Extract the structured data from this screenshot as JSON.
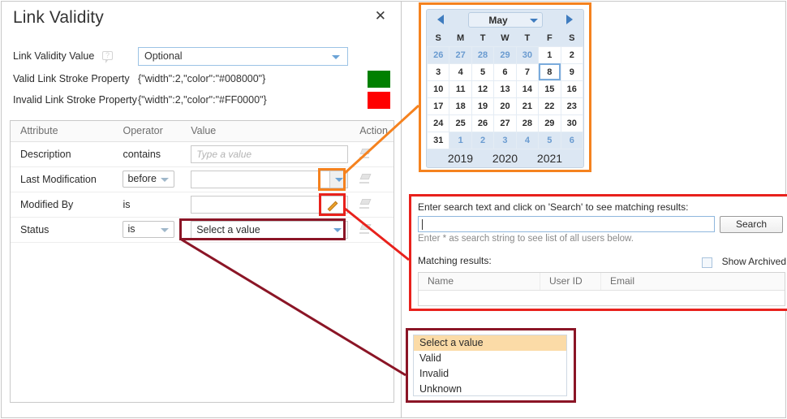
{
  "dialog": {
    "title": "Link Validity",
    "close_label": "✕",
    "properties": [
      {
        "label": "Link Validity Value",
        "help_icon": "help-bubble-icon",
        "control": "combobox",
        "value": "Optional"
      },
      {
        "label": "Valid Link Stroke Property",
        "value": "{\"width\":2,\"color\":\"#008000\"}",
        "swatch_color": "#008000"
      },
      {
        "label": "Invalid Link Stroke Property",
        "value": "{\"width\":2,\"color\":\"#FF0000\"}",
        "swatch_color": "#FF0000"
      }
    ],
    "table": {
      "headers": [
        "Attribute",
        "Operator",
        "Value",
        "Action"
      ],
      "rows": [
        {
          "attribute": "Description",
          "operator": "contains",
          "operator_is_combo": false,
          "value": "",
          "value_placeholder": "Type a value",
          "value_kind": "text",
          "action_icon": "eraser-icon"
        },
        {
          "attribute": "Last Modification",
          "operator": "before",
          "operator_is_combo": true,
          "value": "",
          "value_placeholder": "",
          "value_kind": "date-picker",
          "action_icon": "eraser-icon"
        },
        {
          "attribute": "Modified By",
          "operator": "is",
          "operator_is_combo": false,
          "value": "",
          "value_placeholder": "",
          "value_kind": "user-picker",
          "action_icon": "eraser-icon"
        },
        {
          "attribute": "Status",
          "operator": "is",
          "operator_is_combo": true,
          "value": "Select a value",
          "value_placeholder": "",
          "value_kind": "select",
          "action_icon": "eraser-icon"
        }
      ]
    }
  },
  "calendar": {
    "month": "May",
    "prev_icon": "chevron-left-icon",
    "next_icon": "chevron-right-icon",
    "dropdown_icon": "chevron-down-icon",
    "weekdays": [
      "S",
      "M",
      "T",
      "W",
      "T",
      "F",
      "S"
    ],
    "weeks": [
      [
        {
          "d": "26",
          "o": true
        },
        {
          "d": "27",
          "o": true
        },
        {
          "d": "28",
          "o": true
        },
        {
          "d": "29",
          "o": true
        },
        {
          "d": "30",
          "o": true
        },
        {
          "d": "1",
          "o": false
        },
        {
          "d": "2",
          "o": false
        }
      ],
      [
        {
          "d": "3",
          "o": false
        },
        {
          "d": "4",
          "o": false
        },
        {
          "d": "5",
          "o": false
        },
        {
          "d": "6",
          "o": false
        },
        {
          "d": "7",
          "o": false
        },
        {
          "d": "8",
          "o": false,
          "sel": true
        },
        {
          "d": "9",
          "o": false
        }
      ],
      [
        {
          "d": "10",
          "o": false
        },
        {
          "d": "11",
          "o": false
        },
        {
          "d": "12",
          "o": false
        },
        {
          "d": "13",
          "o": false
        },
        {
          "d": "14",
          "o": false
        },
        {
          "d": "15",
          "o": false
        },
        {
          "d": "16",
          "o": false
        }
      ],
      [
        {
          "d": "17",
          "o": false
        },
        {
          "d": "18",
          "o": false
        },
        {
          "d": "19",
          "o": false
        },
        {
          "d": "20",
          "o": false
        },
        {
          "d": "21",
          "o": false
        },
        {
          "d": "22",
          "o": false
        },
        {
          "d": "23",
          "o": false
        }
      ],
      [
        {
          "d": "24",
          "o": false
        },
        {
          "d": "25",
          "o": false
        },
        {
          "d": "26",
          "o": false
        },
        {
          "d": "27",
          "o": false
        },
        {
          "d": "28",
          "o": false
        },
        {
          "d": "29",
          "o": false
        },
        {
          "d": "30",
          "o": false
        }
      ],
      [
        {
          "d": "31",
          "o": false
        },
        {
          "d": "1",
          "o": true
        },
        {
          "d": "2",
          "o": true
        },
        {
          "d": "3",
          "o": true
        },
        {
          "d": "4",
          "o": true
        },
        {
          "d": "5",
          "o": true
        },
        {
          "d": "6",
          "o": true
        }
      ]
    ],
    "years": [
      "2019",
      "2020",
      "2021"
    ]
  },
  "user_search": {
    "prompt": "Enter search text and click on 'Search' to see matching results:",
    "search_value": "",
    "search_button": "Search",
    "hint": "Enter * as search string to see list of all users below.",
    "matching_label": "Matching results:",
    "show_archived_label": "Show Archived",
    "show_archived_checked": false,
    "result_headers": [
      "Name",
      "User ID",
      "Email"
    ],
    "result_rows": []
  },
  "status_dropdown": {
    "items": [
      "Select a value",
      "Valid",
      "Invalid",
      "Unknown"
    ],
    "selected_index": 0,
    "highlight_color": "#fbdba7"
  },
  "annotations": {
    "orange": "#f5821f",
    "red": "#e8211c",
    "maroon": "#8b1526"
  }
}
